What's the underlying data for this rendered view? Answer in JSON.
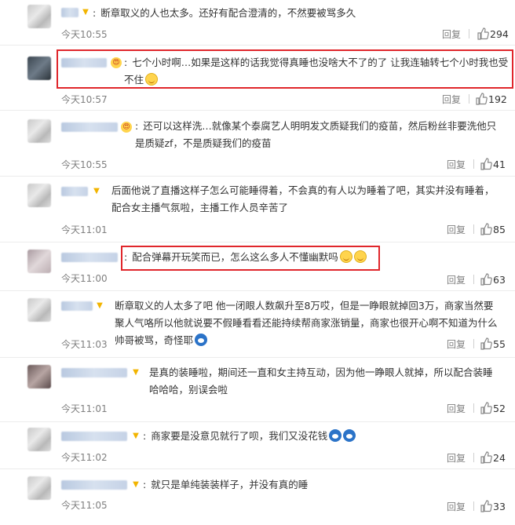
{
  "comments": [
    {
      "text": "断章取义的人也太多。还好有配合澄清的，不然要被骂多久",
      "time": "今天10:55",
      "reply": "回复",
      "likes": "294",
      "badge": "v"
    },
    {
      "text": "七个小时啊…如果是这样的话我觉得真睡也没啥大不了的了 让我连轴转七个小时我也受不住",
      "time": "今天10:57",
      "reply": "回复",
      "likes": "192",
      "badge": "emo"
    },
    {
      "text": "还可以这样洗…就像某个泰腐艺人明明发文质疑我们的疫苗，然后粉丝非要洗他只是质疑zf，不是质疑我们的疫苗",
      "time": "今天10:55",
      "reply": "回复",
      "likes": "41",
      "badge": "emo"
    },
    {
      "text": "后面他说了直播这样子怎么可能睡得着，不会真的有人以为睡着了吧，其实并没有睡着，配合女主播气氛啦，主播工作人员辛苦了",
      "time": "今天11:01",
      "reply": "回复",
      "likes": "85",
      "badge": "v"
    },
    {
      "text": "配合弹幕开玩笑而已，怎么这么多人不懂幽默吗",
      "time": "今天11:00",
      "reply": "回复",
      "likes": "63",
      "badge": "none"
    },
    {
      "text": "断章取义的人太多了吧 他一闭眼人数飙升至8万哎，但是一睁眼就掉回3万，商家当然要聚人气咯所以他就说要不假睡看看还能持续帮商家涨销量，商家也很开心啊不知道为什么帅哥被骂，奇怪耶",
      "time": "今天11:03",
      "reply": "回复",
      "likes": "55",
      "badge": "v"
    },
    {
      "text": "是真的装睡啦，期间还一直和女主持互动，因为他一睁眼人就掉，所以配合装睡哈哈哈，别误会啦",
      "time": "今天11:01",
      "reply": "回复",
      "likes": "52",
      "badge": "v"
    },
    {
      "text": "商家要是没意见就行了呗，我们又没花钱",
      "time": "今天11:02",
      "reply": "回复",
      "likes": "24",
      "badge": "v"
    },
    {
      "text": "就只是单纯装装样子，并没有真的睡",
      "time": "今天11:05",
      "reply": "回复",
      "likes": "33",
      "badge": "v"
    }
  ],
  "colors": {
    "highlight": "#e0262b",
    "time": "#808080",
    "text": "#333333"
  },
  "icons": {
    "like": "thumbs-up-icon",
    "verified": "verified-badge-icon"
  }
}
